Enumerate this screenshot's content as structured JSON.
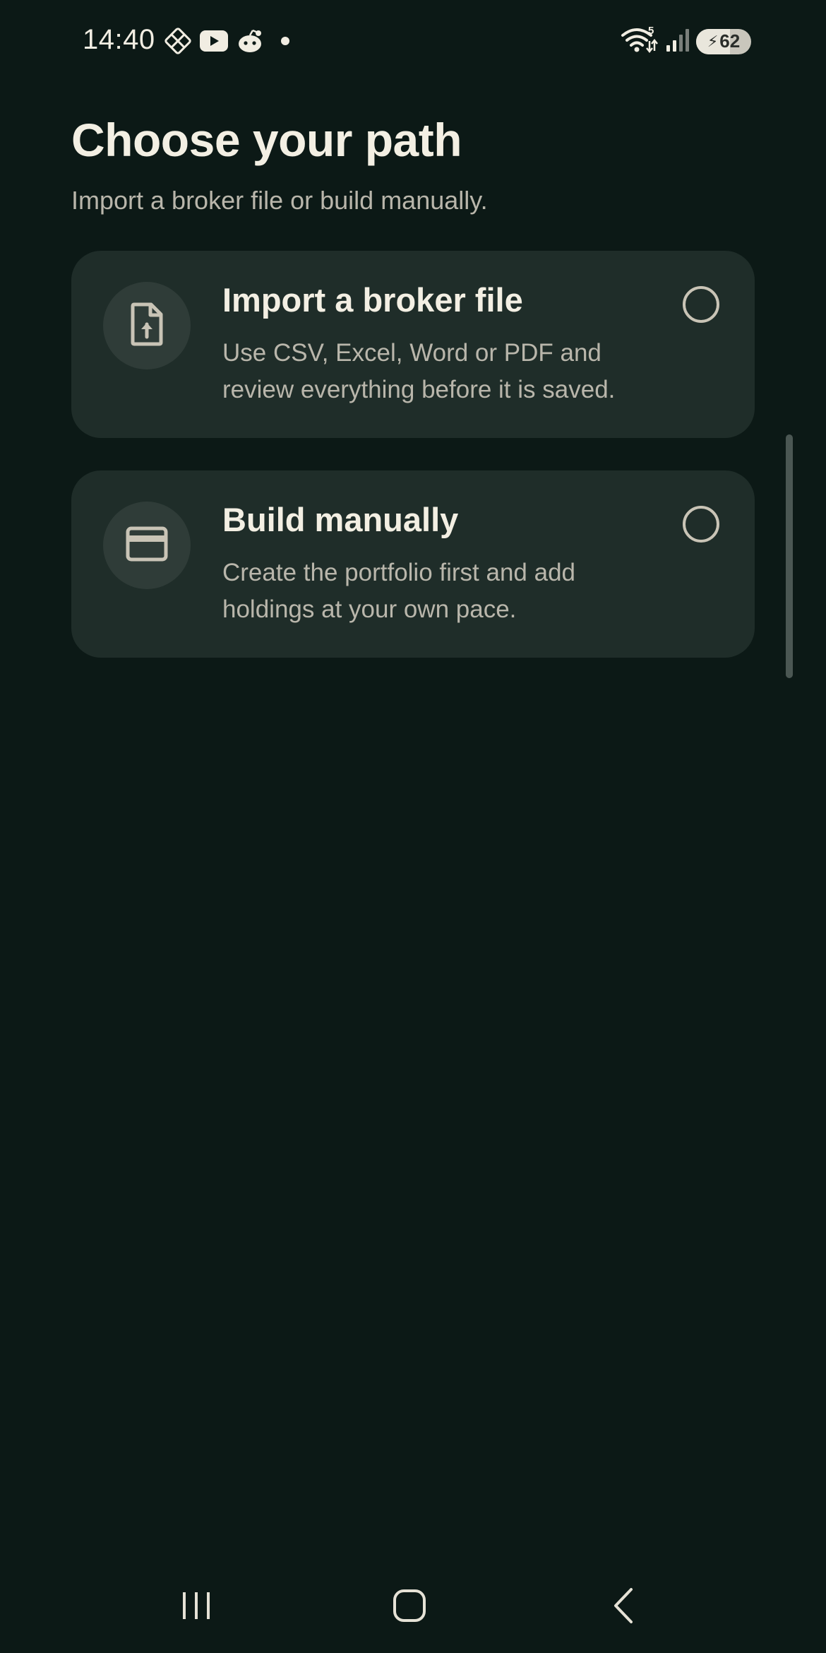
{
  "status_bar": {
    "time": "14:40",
    "notification_icons": [
      "app-icon",
      "youtube-icon",
      "reddit-icon",
      "dot-icon"
    ],
    "wifi_label": "5",
    "battery_level": "62",
    "battery_charging": true
  },
  "header": {
    "title": "Choose your path",
    "subtitle": "Import a broker file or build manually."
  },
  "options": [
    {
      "title": "Import a broker file",
      "description": "Use CSV, Excel, Word or PDF and review everything before it is saved.",
      "icon": "file-upload-icon",
      "selected": false
    },
    {
      "title": "Build manually",
      "description": "Create the portfolio first and add holdings at your own pace.",
      "icon": "card-icon",
      "selected": false
    }
  ],
  "nav_bar": {
    "buttons": [
      "recents",
      "home",
      "back"
    ]
  },
  "colors": {
    "background": "#0c1916",
    "card": "#1f2d29",
    "icon_circle": "#2f3c38",
    "title_text": "#f3efe3",
    "body_text": "#b9b6ab",
    "icon_stroke": "#c9c4b6"
  }
}
